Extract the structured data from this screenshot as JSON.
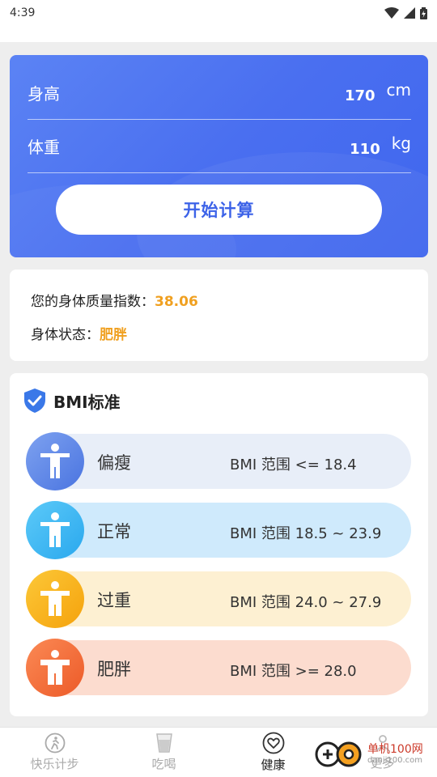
{
  "status_bar": {
    "time": "4:39"
  },
  "calculator": {
    "height_label": "身高",
    "height_value": "170",
    "height_unit": "cm",
    "weight_label": "体重",
    "weight_value": "110",
    "weight_unit": "kg",
    "button_label": "开始计算"
  },
  "result": {
    "bmi_label": "您的身体质量指数：",
    "bmi_value": "38.06",
    "status_label": "身体状态：",
    "status_value": "肥胖"
  },
  "standards": {
    "title": "BMI标准",
    "rows": [
      {
        "name": "偏瘦",
        "range": "BMI 范围 <= 18.4",
        "color": "#4a74e0"
      },
      {
        "name": "正常",
        "range": "BMI 范围 18.5 ~ 23.9",
        "color": "#2aa8ee"
      },
      {
        "name": "过重",
        "range": "BMI 范围 24.0 ~ 27.9",
        "color": "#f5a20c"
      },
      {
        "name": "肥胖",
        "range": "BMI 范围 >= 28.0",
        "color": "#ec5a28"
      }
    ]
  },
  "tabs": [
    {
      "label": "快乐计步",
      "icon": "running-icon"
    },
    {
      "label": "吃喝",
      "icon": "cup-icon"
    },
    {
      "label": "健康",
      "icon": "heart-icon",
      "active": true
    },
    {
      "label": "更多",
      "icon": "more-icon"
    }
  ],
  "watermark": {
    "text": "单机100网",
    "subtext": "danji100.com"
  },
  "colors": {
    "primary": "#4a6ff0",
    "highlight": "#f0a020"
  }
}
